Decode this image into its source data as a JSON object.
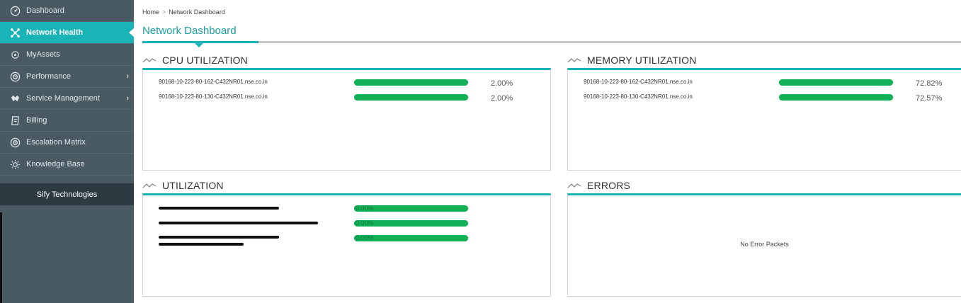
{
  "sidebar": {
    "items": [
      {
        "label": "Dashboard",
        "icon": "dashboard-icon",
        "has_submenu": false
      },
      {
        "label": "Network Health",
        "icon": "network-icon",
        "has_submenu": false,
        "active": true
      },
      {
        "label": "MyAssets",
        "icon": "assets-icon",
        "has_submenu": false
      },
      {
        "label": "Performance",
        "icon": "performance-icon",
        "has_submenu": true
      },
      {
        "label": "Service Management",
        "icon": "service-icon",
        "has_submenu": true
      },
      {
        "label": "Billing",
        "icon": "billing-icon",
        "has_submenu": false
      },
      {
        "label": "Escalation Matrix",
        "icon": "escalation-icon",
        "has_submenu": false
      },
      {
        "label": "Knowledge Base",
        "icon": "bulb-icon",
        "has_submenu": false
      }
    ],
    "company": "Sify Technologies"
  },
  "breadcrumb": {
    "home": "Home",
    "separator": ">",
    "current": "Network Dashboard"
  },
  "page_title": "Network Dashboard",
  "panels": {
    "cpu": {
      "title": "CPU UTILIZATION",
      "rows": [
        {
          "host": "90168-10-223-80-162-C432NR01.nse.co.in",
          "value": "2.00%",
          "fill_pct": 100
        },
        {
          "host": "90168-10-223-80-130-C432NR01.nse.co.in",
          "value": "2.00%",
          "fill_pct": 100
        }
      ]
    },
    "memory": {
      "title": "MEMORY UTILIZATION",
      "rows": [
        {
          "host": "90168-10-223-80-162-C432NR01.nse.co.in",
          "value": "72.82%",
          "fill_pct": 100
        },
        {
          "host": "90168-10-223-80-130-C432NR01.nse.co.in",
          "value": "72.57%",
          "fill_pct": 100
        }
      ]
    },
    "utilization": {
      "title": "UTILIZATION",
      "rows": [
        {
          "bar_label": "0.00%",
          "fill_pct": 100
        },
        {
          "bar_label": "0.00%",
          "fill_pct": 100
        },
        {
          "bar_label": "0.00%",
          "fill_pct": 100
        }
      ]
    },
    "errors": {
      "title": "ERRORS",
      "empty_message": "No Error Packets"
    }
  },
  "colors": {
    "accent": "#1ab3b8",
    "sidebar_bg": "#4a5a63",
    "bar_green": "#13b157"
  }
}
